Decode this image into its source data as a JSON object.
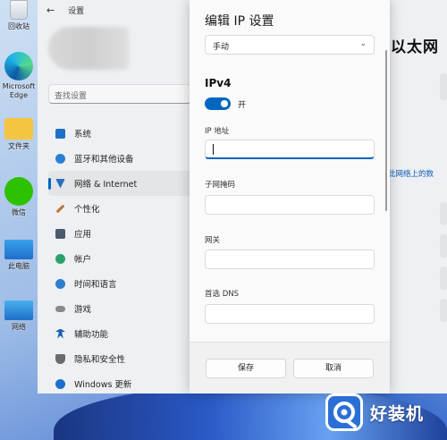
{
  "desktop": {
    "icons": [
      {
        "label": "回收站"
      },
      {
        "label": "Microsoft Edge"
      },
      {
        "label": "文件夹"
      },
      {
        "label": "微信"
      },
      {
        "label": "此电脑"
      },
      {
        "label": "网络"
      }
    ]
  },
  "settings": {
    "title": "设置",
    "search_placeholder": "查找设置",
    "nav": [
      {
        "label": "系统",
        "icon": "monitor-icon",
        "color": "#1f6fc9"
      },
      {
        "label": "蓝牙和其他设备",
        "icon": "bluetooth-icon",
        "color": "#2a7fd4"
      },
      {
        "label": "网络 & Internet",
        "icon": "wifi-icon",
        "color": "#2a6fc0"
      },
      {
        "label": "个性化",
        "icon": "brush-icon",
        "color": "#b87333"
      },
      {
        "label": "应用",
        "icon": "apps-icon",
        "color": "#4b5a6d"
      },
      {
        "label": "帐户",
        "icon": "person-icon",
        "color": "#2aa26a"
      },
      {
        "label": "时间和语言",
        "icon": "globe-clock-icon",
        "color": "#2c7fcd"
      },
      {
        "label": "游戏",
        "icon": "gamepad-icon",
        "color": "#8a8a8a"
      },
      {
        "label": "辅助功能",
        "icon": "accessibility-icon",
        "color": "#1f5fae"
      },
      {
        "label": "隐私和安全性",
        "icon": "shield-icon",
        "color": "#6b6b6b"
      },
      {
        "label": "Windows 更新",
        "icon": "update-icon",
        "color": "#1f6fc9"
      }
    ],
    "right_title": "以太网",
    "right_link": "此网络上的数"
  },
  "dialog": {
    "title": "编辑 IP 设置",
    "mode_value": "手动",
    "section": "IPv4",
    "toggle_label": "开",
    "fields": [
      {
        "label": "IP 地址",
        "value": ""
      },
      {
        "label": "子网掩码",
        "value": ""
      },
      {
        "label": "网关",
        "value": ""
      },
      {
        "label": "首选 DNS",
        "value": ""
      }
    ],
    "save_label": "保存",
    "cancel_label": "取消"
  },
  "watermark": {
    "text": "好装机"
  },
  "colors": {
    "accent": "#0067c0"
  }
}
